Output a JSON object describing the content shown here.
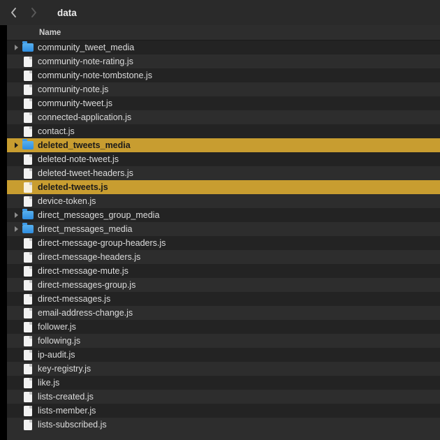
{
  "nav": {
    "path_title": "data"
  },
  "columns": {
    "name": "Name"
  },
  "files": [
    {
      "name": "community_tweet_media",
      "type": "folder",
      "expandable": true,
      "selected": false
    },
    {
      "name": "community-note-rating.js",
      "type": "file",
      "expandable": false,
      "selected": false
    },
    {
      "name": "community-note-tombstone.js",
      "type": "file",
      "expandable": false,
      "selected": false
    },
    {
      "name": "community-note.js",
      "type": "file",
      "expandable": false,
      "selected": false
    },
    {
      "name": "community-tweet.js",
      "type": "file",
      "expandable": false,
      "selected": false
    },
    {
      "name": "connected-application.js",
      "type": "file",
      "expandable": false,
      "selected": false
    },
    {
      "name": "contact.js",
      "type": "file",
      "expandable": false,
      "selected": false
    },
    {
      "name": "deleted_tweets_media",
      "type": "folder",
      "expandable": true,
      "selected": true
    },
    {
      "name": "deleted-note-tweet.js",
      "type": "file",
      "expandable": false,
      "selected": false
    },
    {
      "name": "deleted-tweet-headers.js",
      "type": "file",
      "expandable": false,
      "selected": false
    },
    {
      "name": "deleted-tweets.js",
      "type": "file",
      "expandable": false,
      "selected": true
    },
    {
      "name": "device-token.js",
      "type": "file",
      "expandable": false,
      "selected": false
    },
    {
      "name": "direct_messages_group_media",
      "type": "folder",
      "expandable": true,
      "selected": false
    },
    {
      "name": "direct_messages_media",
      "type": "folder",
      "expandable": true,
      "selected": false
    },
    {
      "name": "direct-message-group-headers.js",
      "type": "file",
      "expandable": false,
      "selected": false
    },
    {
      "name": "direct-message-headers.js",
      "type": "file",
      "expandable": false,
      "selected": false
    },
    {
      "name": "direct-message-mute.js",
      "type": "file",
      "expandable": false,
      "selected": false
    },
    {
      "name": "direct-messages-group.js",
      "type": "file",
      "expandable": false,
      "selected": false
    },
    {
      "name": "direct-messages.js",
      "type": "file",
      "expandable": false,
      "selected": false
    },
    {
      "name": "email-address-change.js",
      "type": "file",
      "expandable": false,
      "selected": false
    },
    {
      "name": "follower.js",
      "type": "file",
      "expandable": false,
      "selected": false
    },
    {
      "name": "following.js",
      "type": "file",
      "expandable": false,
      "selected": false
    },
    {
      "name": "ip-audit.js",
      "type": "file",
      "expandable": false,
      "selected": false
    },
    {
      "name": "key-registry.js",
      "type": "file",
      "expandable": false,
      "selected": false
    },
    {
      "name": "like.js",
      "type": "file",
      "expandable": false,
      "selected": false
    },
    {
      "name": "lists-created.js",
      "type": "file",
      "expandable": false,
      "selected": false
    },
    {
      "name": "lists-member.js",
      "type": "file",
      "expandable": false,
      "selected": false
    },
    {
      "name": "lists-subscribed.js",
      "type": "file",
      "expandable": false,
      "selected": false
    }
  ]
}
